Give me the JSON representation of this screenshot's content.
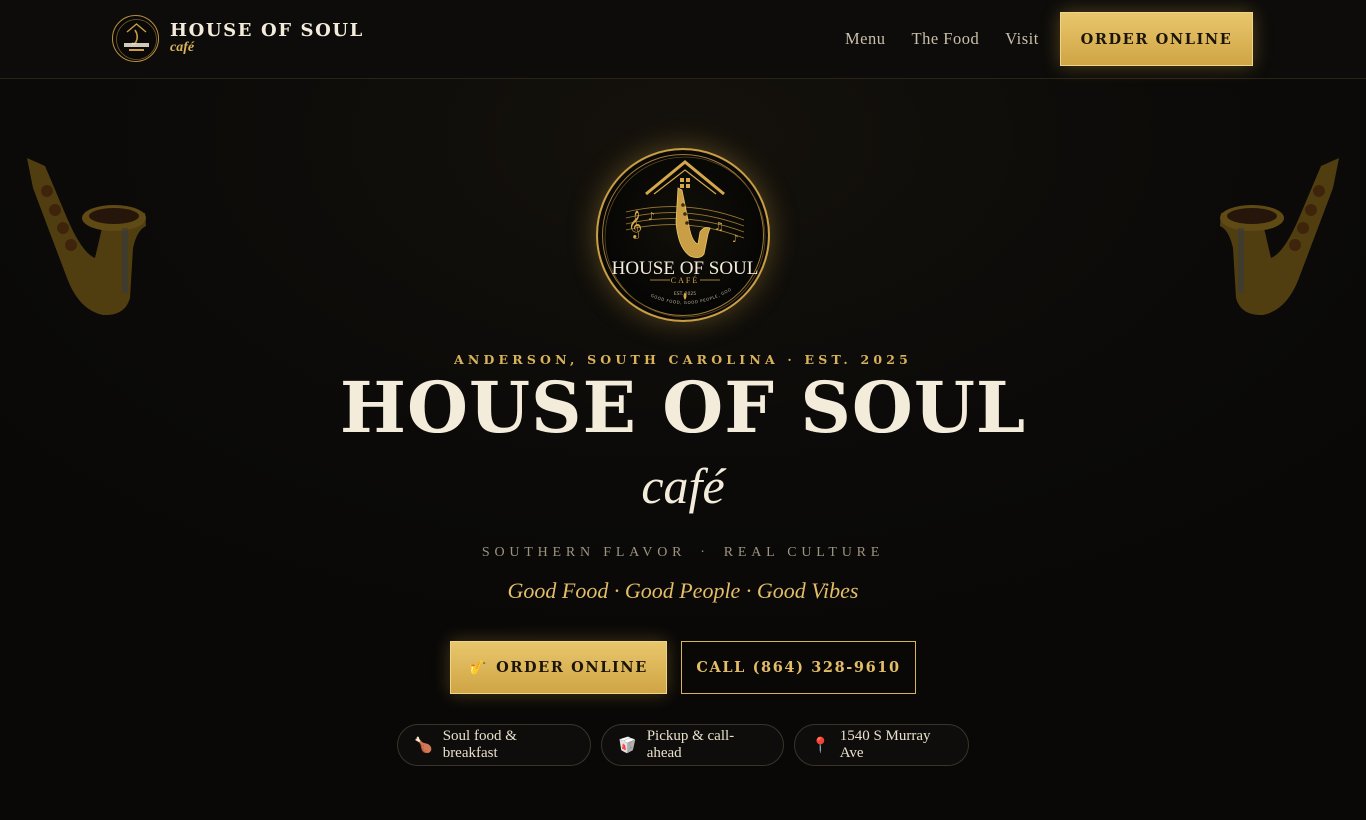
{
  "brand": {
    "name": "HOUSE OF SOUL",
    "sub": "café"
  },
  "nav": {
    "links": [
      "Menu",
      "The Food",
      "Visit"
    ],
    "order_label": "ORDER ONLINE"
  },
  "hero": {
    "eyebrow": "ANDERSON, SOUTH CAROLINA · EST. 2025",
    "title": "HOUSE OF SOUL",
    "cafe": "café",
    "tagline_left": "SOUTHERN FLAVOR",
    "tagline_sep": "·",
    "tagline_right": "REAL CULTURE",
    "motto": "Good Food · Good People · Good Vibes",
    "order_icon": "🎷",
    "order_label": "ORDER ONLINE",
    "call_label": "CALL (864) 328-9610"
  },
  "logo": {
    "name": "HOUSE OF SOUL",
    "sub": "CAFÉ",
    "est": "EST. 2025",
    "ring_text": "GOOD FOOD, GOOD PEOPLE, GOOD VIBES"
  },
  "chips": [
    {
      "icon": "🍗",
      "label": "Soul food & breakfast"
    },
    {
      "icon": "🥡",
      "label": "Pickup & call-ahead"
    },
    {
      "icon": "📍",
      "label": "1540 S Murray Ave"
    }
  ],
  "colors": {
    "gold": "#d9b35a",
    "background": "#0b0a08",
    "cream": "#f4ecdb"
  }
}
